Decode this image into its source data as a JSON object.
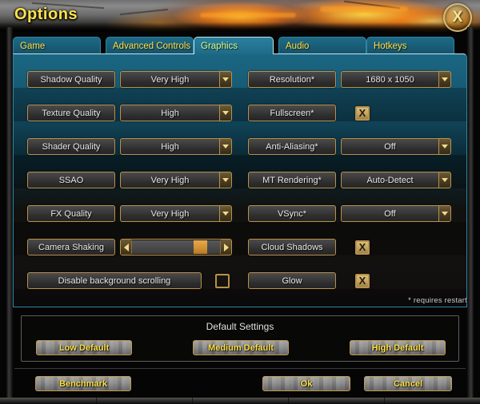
{
  "window": {
    "title": "Options",
    "close_label": "X",
    "close_icon": "close-icon"
  },
  "tabs": [
    {
      "label": "Game",
      "active": false
    },
    {
      "label": "Advanced Controls",
      "active": false
    },
    {
      "label": "Graphics",
      "active": true
    },
    {
      "label": "Audio",
      "active": false
    },
    {
      "label": "Hotkeys",
      "active": false
    }
  ],
  "settings": {
    "left_column": [
      {
        "label": "Shadow Quality",
        "type": "dropdown",
        "value": "Very High"
      },
      {
        "label": "Texture Quality",
        "type": "dropdown",
        "value": "High"
      },
      {
        "label": "Shader Quality",
        "type": "dropdown",
        "value": "High"
      },
      {
        "label": "SSAO",
        "type": "dropdown",
        "value": "Very High"
      },
      {
        "label": "FX Quality",
        "type": "dropdown",
        "value": "Very High"
      },
      {
        "label": "Camera Shaking",
        "type": "slider",
        "value": 85
      },
      {
        "label": "Disable background scrolling",
        "type": "checkbox",
        "checked": false
      }
    ],
    "right_column": [
      {
        "label": "Resolution*",
        "type": "dropdown",
        "value": "1680 x 1050"
      },
      {
        "label": "Fullscreen*",
        "type": "checkbox",
        "checked": true
      },
      {
        "label": "Anti-Aliasing*",
        "type": "dropdown",
        "value": "Off"
      },
      {
        "label": "MT Rendering*",
        "type": "dropdown",
        "value": "Auto-Detect"
      },
      {
        "label": "VSync*",
        "type": "dropdown",
        "value": "Off"
      },
      {
        "label": "Cloud Shadows",
        "type": "checkbox",
        "checked": true
      },
      {
        "label": "Glow",
        "type": "checkbox",
        "checked": true
      }
    ],
    "footnote": "* requires restart",
    "checkbox_mark": "X",
    "dropdown_icon": "chevron-down-icon"
  },
  "defaults": {
    "header": "Default Settings",
    "buttons": [
      {
        "label": "Low Default"
      },
      {
        "label": "Medium Default"
      },
      {
        "label": "High Default"
      }
    ]
  },
  "actions": {
    "benchmark": "Benchmark",
    "ok": "Ok",
    "cancel": "Cancel"
  },
  "colors": {
    "gold_border": "#b8914a",
    "yellow_text": "#ffe34a",
    "panel_teal": "#1b6783",
    "tab_active_border": "#bfe6f2",
    "slider_thumb": "#d08f32"
  }
}
